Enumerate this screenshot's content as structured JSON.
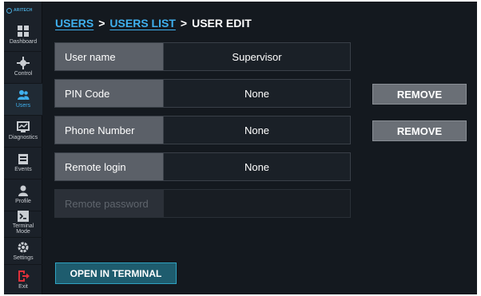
{
  "sidebar": {
    "logo_text": "ARITECH",
    "items": [
      {
        "label": "Dashboard",
        "icon": "dashboard-icon"
      },
      {
        "label": "Control",
        "icon": "control-icon"
      },
      {
        "label": "Users",
        "icon": "users-icon",
        "active": true
      },
      {
        "label": "Diagnostics",
        "icon": "diagnostics-icon"
      },
      {
        "label": "Events",
        "icon": "events-icon"
      },
      {
        "label": "Profile",
        "icon": "profile-icon"
      },
      {
        "label": "Terminal\nMode",
        "icon": "terminal-icon"
      },
      {
        "label": "Settings",
        "icon": "settings-icon"
      },
      {
        "label": "Exit",
        "icon": "exit-icon"
      }
    ]
  },
  "breadcrumb": {
    "users": "USERS",
    "sep1": ">",
    "users_list": "USERS LIST",
    "sep2": ">",
    "current": "USER EDIT"
  },
  "form": {
    "user_name": {
      "label": "User name",
      "value": "Supervisor"
    },
    "pin_code": {
      "label": "PIN Code",
      "value": "None"
    },
    "phone_number": {
      "label": "Phone Number",
      "value": "None"
    },
    "remote_login": {
      "label": "Remote login",
      "value": "None"
    },
    "remote_password": {
      "label": "Remote password",
      "value": ""
    }
  },
  "buttons": {
    "remove_pin": "REMOVE",
    "remove_phone": "REMOVE",
    "open_in_terminal": "OPEN IN TERMINAL"
  },
  "colors": {
    "accent": "#3fb0ee",
    "exit_red": "#e0303a",
    "background": "#14191f"
  }
}
